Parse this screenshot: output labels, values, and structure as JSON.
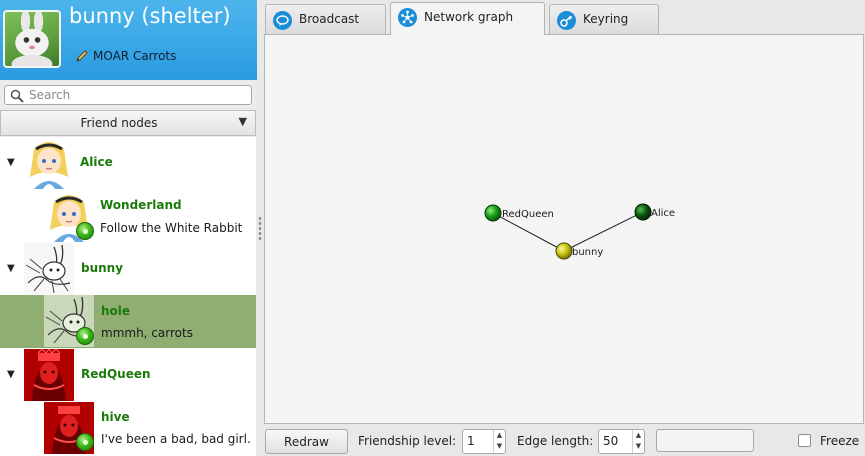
{
  "profile": {
    "name": "bunny (shelter)",
    "status": "MOAR Carrots"
  },
  "search": {
    "placeholder": "Search",
    "value": ""
  },
  "tree": {
    "header": "Friend nodes",
    "items": [
      {
        "type": "friend",
        "name": "Alice",
        "expanded": true,
        "avatar": "alice-avatar"
      },
      {
        "type": "location",
        "name": "Wonderland",
        "status": "Follow the White Rabbit",
        "online": true,
        "avatar": "alice-avatar"
      },
      {
        "type": "friend",
        "name": "bunny",
        "expanded": true,
        "avatar": "rabbit-sketch-avatar"
      },
      {
        "type": "location",
        "name": "hole",
        "status": "mmmh, carrots",
        "online": true,
        "selected": true,
        "avatar": "rabbit-sketch-avatar"
      },
      {
        "type": "friend",
        "name": "RedQueen",
        "expanded": true,
        "avatar": "red-queen-avatar"
      },
      {
        "type": "location",
        "name": "hive",
        "status": "I've been a bad, bad girl.",
        "online": true,
        "avatar": "red-queen-avatar"
      }
    ]
  },
  "tabs": [
    {
      "label": "Broadcast",
      "icon": "chat-bubble-icon",
      "active": false
    },
    {
      "label": "Network graph",
      "icon": "network-icon",
      "active": true
    },
    {
      "label": "Keyring",
      "icon": "key-icon",
      "active": false
    }
  ],
  "graph": {
    "nodes": [
      {
        "label": "RedQueen",
        "color": "#19a019"
      },
      {
        "label": "Alice",
        "color": "#0d5a0d"
      },
      {
        "label": "bunny",
        "color": "#c8c410"
      }
    ],
    "edges": [
      [
        "RedQueen",
        "bunny"
      ],
      [
        "Alice",
        "bunny"
      ]
    ]
  },
  "controls": {
    "redraw_label": "Redraw",
    "friendship_label": "Friendship level:",
    "friendship_value": "1",
    "edge_label": "Edge length:",
    "edge_value": "50",
    "extra_value": "",
    "freeze_label": "Freeze",
    "freeze_checked": false
  },
  "colors": {
    "header_blue": "#2a9be0",
    "selected_row": "#90ad72",
    "friend_name": "#1a7a0a",
    "tab_icon": "#1a8dd8"
  }
}
